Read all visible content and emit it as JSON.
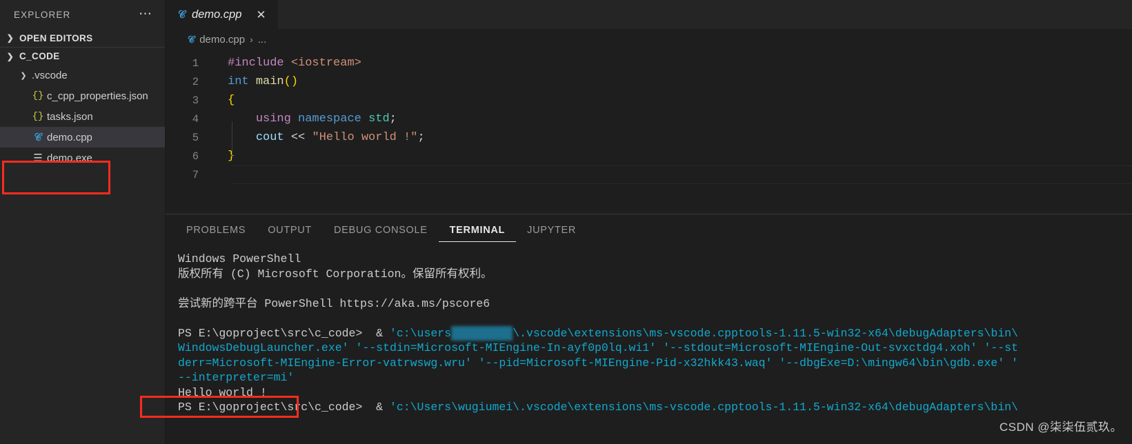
{
  "sidebar": {
    "title": "EXPLORER",
    "more_icon": "ellipsis-icon",
    "sections": [
      {
        "label": "OPEN EDITORS",
        "chevron": "chevron-right-icon"
      },
      {
        "label": "C_CODE",
        "chevron": "chevron-down-icon"
      }
    ],
    "tree": [
      {
        "label": ".vscode",
        "icon": "chevron-down-icon",
        "depth": 1,
        "selected": false
      },
      {
        "label": "c_cpp_properties.json",
        "icon": "json-icon",
        "glyph": "{}",
        "depth": 2,
        "selected": false
      },
      {
        "label": "tasks.json",
        "icon": "json-icon",
        "glyph": "{}",
        "depth": 2,
        "selected": false
      },
      {
        "label": "demo.cpp",
        "icon": "cpp-file-icon",
        "glyph": "C",
        "depth": 2,
        "selected": true
      },
      {
        "label": "demo.exe",
        "icon": "executable-icon",
        "glyph": "☰",
        "depth": 2,
        "selected": false
      }
    ]
  },
  "editor": {
    "tab": {
      "name": "demo.cpp",
      "icon": "cpp-file-icon",
      "close_icon": "close-icon"
    },
    "breadcrumb": {
      "file": "demo.cpp",
      "separator": "›",
      "rest": "..."
    },
    "lines": [
      {
        "num": "1",
        "tokens": [
          {
            "t": "#include ",
            "c": "t-pre"
          },
          {
            "t": "<iostream>",
            "c": "t-str2"
          }
        ]
      },
      {
        "num": "2",
        "tokens": [
          {
            "t": "int ",
            "c": "t-kw"
          },
          {
            "t": "main",
            "c": "t-fn"
          },
          {
            "t": "()",
            "c": "t-paren"
          }
        ]
      },
      {
        "num": "3",
        "tokens": [
          {
            "t": "{",
            "c": "t-brace"
          }
        ]
      },
      {
        "num": "4",
        "tokens": [
          {
            "t": "    ",
            "c": "t-op"
          },
          {
            "t": "using ",
            "c": "t-pre"
          },
          {
            "t": "namespace ",
            "c": "t-kw"
          },
          {
            "t": "std",
            "c": "t-type"
          },
          {
            "t": ";",
            "c": "t-op"
          }
        ]
      },
      {
        "num": "5",
        "tokens": [
          {
            "t": "    ",
            "c": "t-op"
          },
          {
            "t": "cout ",
            "c": "t-var"
          },
          {
            "t": "<< ",
            "c": "t-op"
          },
          {
            "t": "\"Hello world !\"",
            "c": "t-str2"
          },
          {
            "t": ";",
            "c": "t-op"
          }
        ]
      },
      {
        "num": "6",
        "tokens": [
          {
            "t": "}",
            "c": "t-brace"
          }
        ]
      },
      {
        "num": "7",
        "tokens": []
      }
    ]
  },
  "panel": {
    "tabs": [
      {
        "label": "PROBLEMS",
        "active": false
      },
      {
        "label": "OUTPUT",
        "active": false
      },
      {
        "label": "DEBUG CONSOLE",
        "active": false
      },
      {
        "label": "TERMINAL",
        "active": true
      },
      {
        "label": "JUPYTER",
        "active": false
      }
    ],
    "terminal_lines": [
      {
        "type": "text",
        "spans": [
          {
            "t": "Windows PowerShell",
            "c": "c-white"
          }
        ]
      },
      {
        "type": "text",
        "spans": [
          {
            "t": "版权所有 (C) Microsoft Corporation。保留所有权利。",
            "c": "c-white"
          }
        ]
      },
      {
        "type": "blank"
      },
      {
        "type": "text",
        "spans": [
          {
            "t": "尝试新的跨平台 PowerShell https://aka.ms/pscore6",
            "c": "c-white"
          }
        ]
      },
      {
        "type": "blank"
      },
      {
        "type": "text",
        "spans": [
          {
            "t": "PS E:\\goproject\\src\\c_code>  & ",
            "c": "c-white"
          },
          {
            "t": "'c:\\users",
            "c": "c-cyan"
          },
          {
            "t": "\\wugiumei",
            "c": "c-redact"
          },
          {
            "t": "\\.vscode\\extensions\\ms-vscode.cpptools-1.11.5-win32-x64\\debugAdapters\\bin\\",
            "c": "c-cyan"
          }
        ]
      },
      {
        "type": "text",
        "spans": [
          {
            "t": "WindowsDebugLauncher.exe' '--stdin=Microsoft-MIEngine-In-ayf0p0lq.wi1' '--stdout=Microsoft-MIEngine-Out-svxctdg4.xoh' '--st",
            "c": "c-cyan"
          }
        ]
      },
      {
        "type": "text",
        "spans": [
          {
            "t": "derr=Microsoft-MIEngine-Error-vatrwswg.wru' '--pid=Microsoft-MIEngine-Pid-x32hkk43.waq' '--dbgExe=D:\\mingw64\\bin\\gdb.exe' '",
            "c": "c-cyan"
          }
        ]
      },
      {
        "type": "text",
        "spans": [
          {
            "t": "--interpreter=mi'",
            "c": "c-cyan"
          }
        ]
      },
      {
        "type": "text",
        "spans": [
          {
            "t": "Hello world !",
            "c": "c-white"
          }
        ]
      },
      {
        "type": "text",
        "spans": [
          {
            "t": "PS E:\\goproject\\src\\c_code>  & ",
            "c": "c-white"
          },
          {
            "t": "'c:\\Users\\wugiumei\\.vscode\\extensions\\ms-vscode.cpptools-1.11.5-win32-x64\\debugAdapters\\bin\\",
            "c": "c-cyan"
          }
        ]
      }
    ]
  },
  "annotations": {
    "highlight_exe": "demo.exe",
    "highlight_output": "Hello world !",
    "box_color": "#fb2c1e"
  },
  "watermark": "CSDN @柒柒伍贰玖。"
}
